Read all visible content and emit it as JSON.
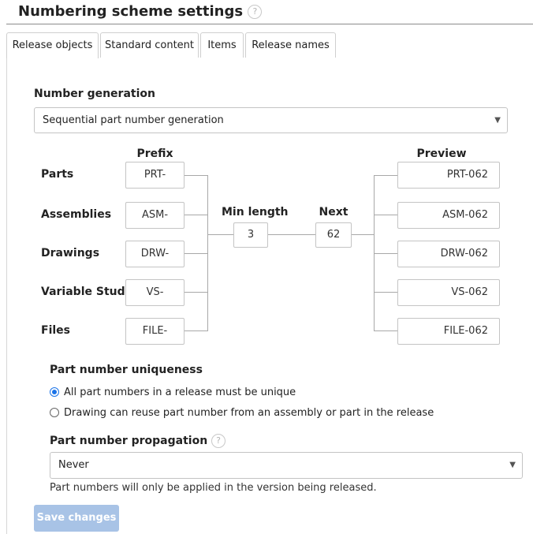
{
  "page_title": "Numbering scheme settings",
  "help_glyph": "?",
  "tabs": [
    {
      "label": "Release objects",
      "active": true
    },
    {
      "label": "Standard content",
      "active": false
    },
    {
      "label": "Items",
      "active": false
    },
    {
      "label": "Release names",
      "active": false
    }
  ],
  "number_generation": {
    "label": "Number generation",
    "selected": "Sequential part number generation",
    "caret_icon": "caret-down-icon"
  },
  "scheme": {
    "prefix_header": "Prefix",
    "preview_header": "Preview",
    "min_length_label": "Min length",
    "min_length_value": "3",
    "next_label": "Next",
    "next_value": "62",
    "rows": [
      {
        "label": "Parts",
        "prefix": "PRT-",
        "preview": "PRT-062"
      },
      {
        "label": "Assemblies",
        "prefix": "ASM-",
        "preview": "ASM-062"
      },
      {
        "label": "Drawings",
        "prefix": "DRW-",
        "preview": "DRW-062"
      },
      {
        "label": "Variable Studios",
        "prefix": "VS-",
        "preview": "VS-062"
      },
      {
        "label": "Files",
        "prefix": "FILE-",
        "preview": "FILE-062"
      }
    ]
  },
  "uniqueness": {
    "label": "Part number uniqueness",
    "options": [
      {
        "label": "All part numbers in a release must be unique",
        "selected": true
      },
      {
        "label": "Drawing can reuse part number from an assembly or part in the release",
        "selected": false
      }
    ]
  },
  "propagation": {
    "label": "Part number propagation",
    "selected": "Never",
    "note": "Part numbers will only be applied in the version being released."
  },
  "save_button": {
    "label": "Save changes",
    "enabled": false
  },
  "colors": {
    "accent": "#1a73e8",
    "disabled_button": "#a8c3e6",
    "connector_line": "#a8a8a8"
  }
}
